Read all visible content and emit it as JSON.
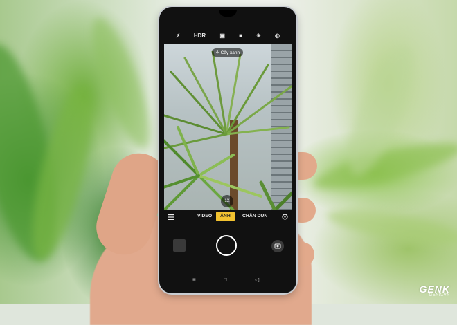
{
  "camera": {
    "top_bar": {
      "hdr_label": "HDR"
    },
    "scene_tag": "Cây xanh",
    "zoom_label": "1X",
    "modes": {
      "video": "VIDEO",
      "photo": "ẢNH",
      "portrait": "CHÂN DUN"
    }
  },
  "watermark": {
    "logo": "GENK",
    "url": "GENK.VN"
  },
  "colors": {
    "accent": "#f2c230",
    "phone_body": "#111111"
  }
}
